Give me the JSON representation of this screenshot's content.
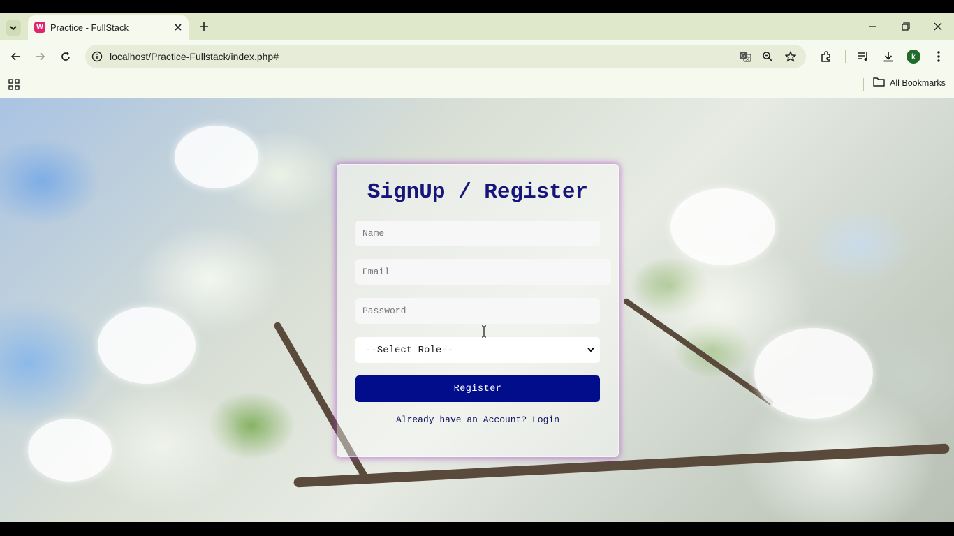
{
  "browser": {
    "tab": {
      "title": "Practice - FullStack",
      "favicon_letter": "W"
    },
    "url": "localhost/Practice-Fullstack/index.php#",
    "avatar_letter": "k",
    "bookmarks": {
      "all_bookmarks_label": "All Bookmarks"
    }
  },
  "form": {
    "title": "SignUp / Register",
    "name_placeholder": "Name",
    "email_placeholder": "Email",
    "password_placeholder": "Password",
    "role_selected": "--Select Role--",
    "register_label": "Register",
    "login_link": "Already have an Account? Login"
  },
  "colors": {
    "chrome_bg": "#f6f9ee",
    "tabstrip_bg": "#dfe8ca",
    "title_color": "#15157a",
    "button_bg": "#020d8c",
    "card_glow": "#aa3cc8"
  },
  "icons": [
    "tab-search-icon",
    "close-icon",
    "plus-icon",
    "minimize-icon",
    "restore-icon",
    "back-icon",
    "forward-icon",
    "reload-icon",
    "info-icon",
    "translate-icon",
    "zoom-icon",
    "star-icon",
    "extensions-icon",
    "media-icon",
    "download-icon",
    "menu-icon",
    "apps-icon",
    "folder-icon",
    "chevron-down-icon"
  ]
}
